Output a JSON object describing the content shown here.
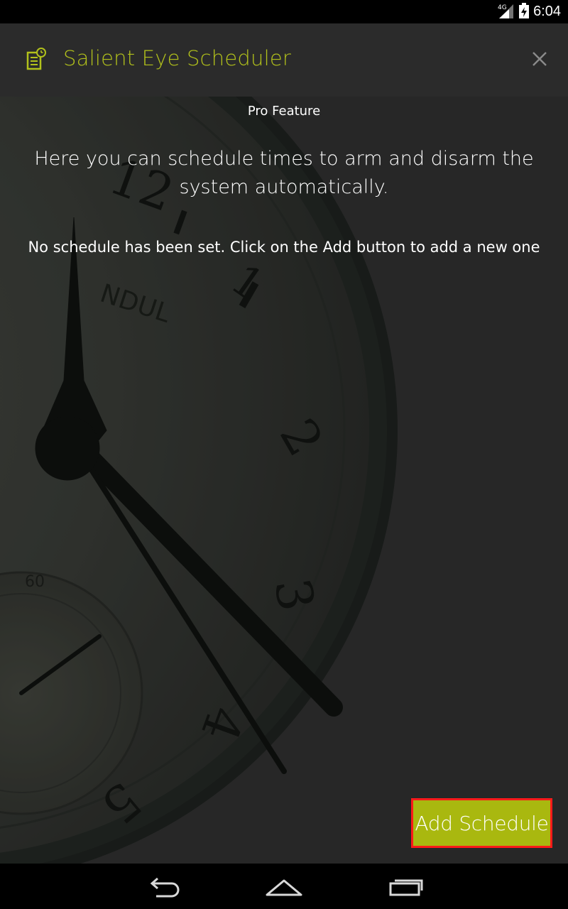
{
  "status_bar": {
    "time": "6:04",
    "network_label": "4G",
    "icons": [
      "signal-icon",
      "battery-icon"
    ]
  },
  "app_bar": {
    "title": "Salient Eye Scheduler",
    "icon": "scheduler-icon",
    "close_icon": "close-icon"
  },
  "content": {
    "pro_feature": "Pro Feature",
    "intro": "Here you can schedule times to arm and disarm the system automatically.",
    "empty_message": "No schedule has been set. Click on the Add button to add a new one",
    "add_button_label": "Add Schedule"
  },
  "nav_bar": {
    "buttons": [
      "back-icon",
      "home-icon",
      "recent-apps-icon"
    ]
  },
  "colors": {
    "accent": "#a9b80f",
    "title": "#b2c11b",
    "app_bar_bg": "#2b2b2b",
    "content_bg": "#333333",
    "highlight_border": "#ff1a1a"
  }
}
